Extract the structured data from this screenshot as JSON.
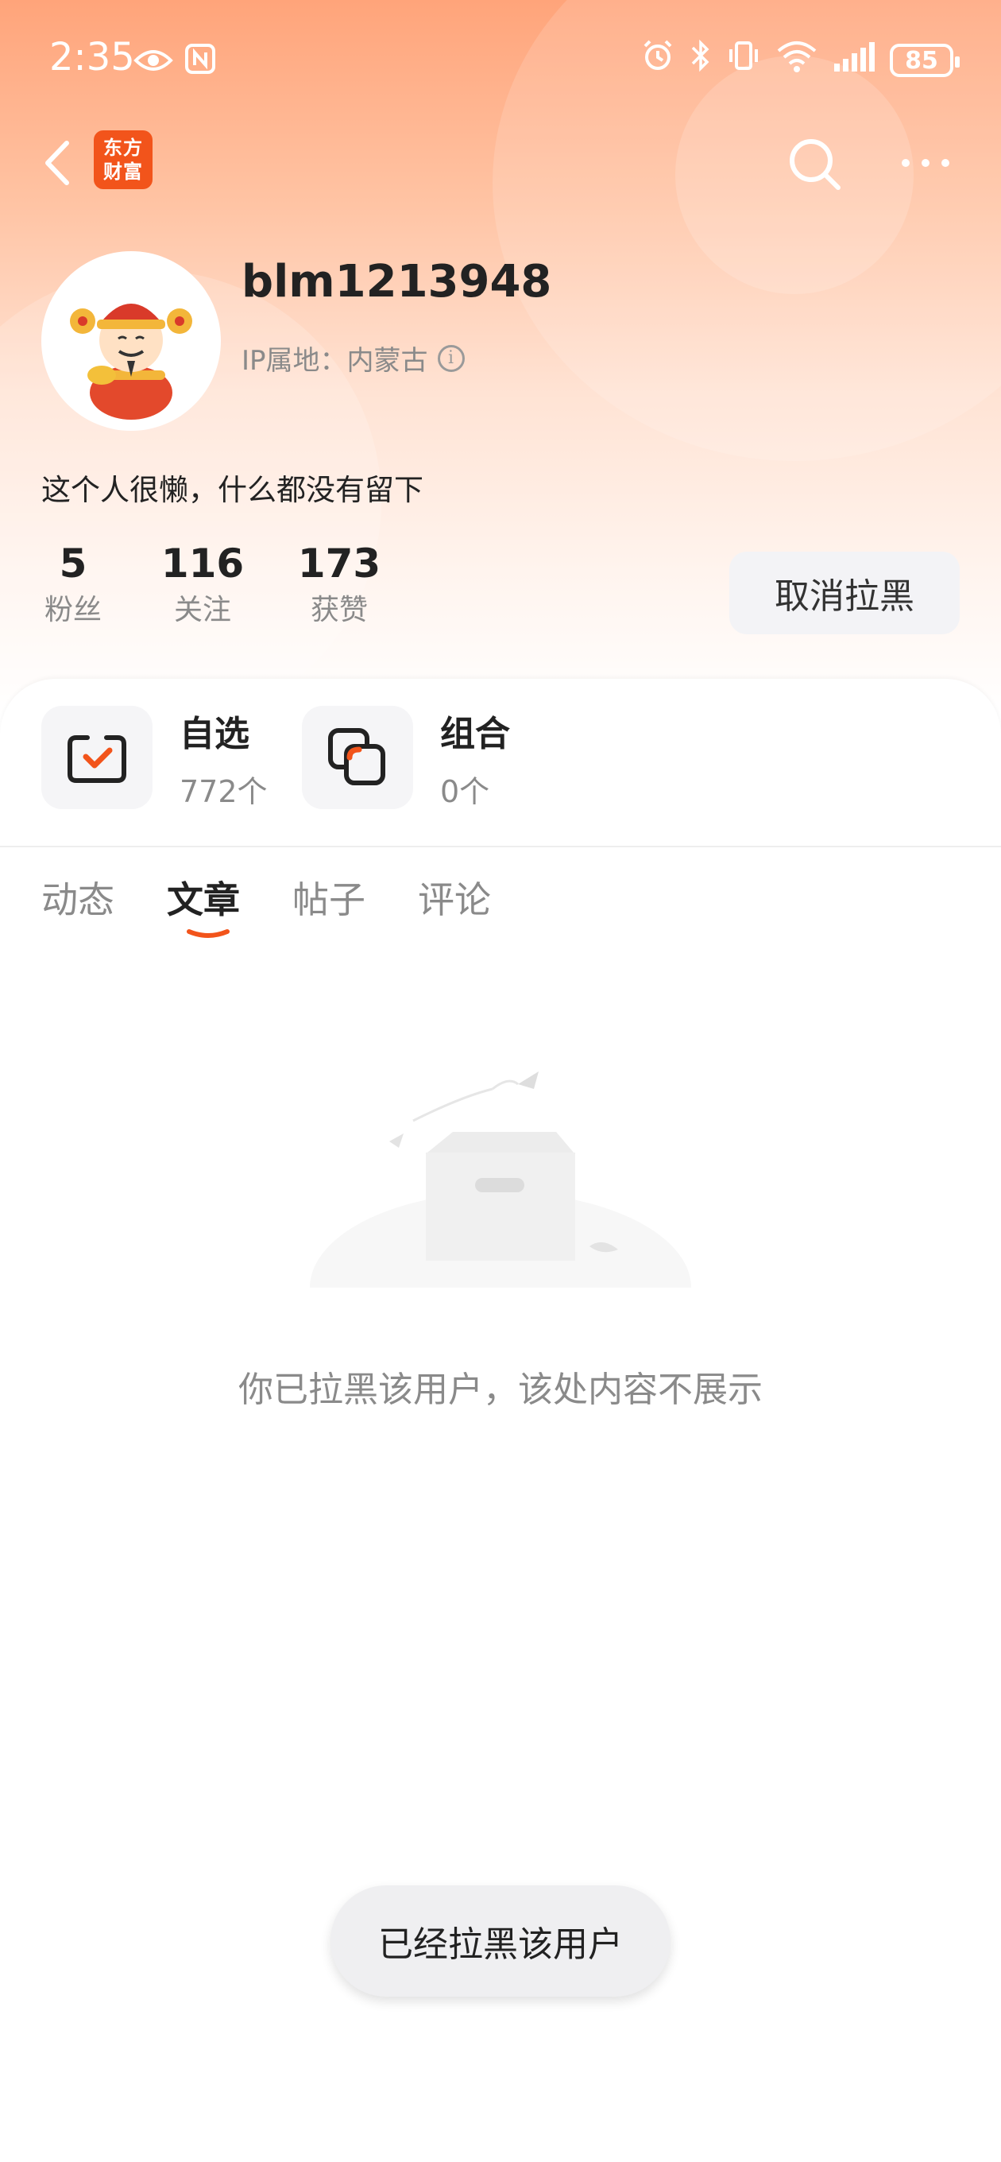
{
  "status_bar": {
    "time": "2:35",
    "battery": "85"
  },
  "app": {
    "logo_text_line1": "东方",
    "logo_text_line2": "财富"
  },
  "profile": {
    "username": "blm1213948",
    "ip_location": "IP属地：内蒙古",
    "bio": "这个人很懒，什么都没有留下",
    "stats": [
      {
        "value": "5",
        "label": "粉丝"
      },
      {
        "value": "116",
        "label": "关注"
      },
      {
        "value": "173",
        "label": "获赞"
      }
    ],
    "unblock_label": "取消拉黑"
  },
  "quick_entries": [
    {
      "title": "自选",
      "sub": "772个"
    },
    {
      "title": "组合",
      "sub": "0个"
    }
  ],
  "tabs": [
    {
      "label": "动态"
    },
    {
      "label": "文章"
    },
    {
      "label": "帖子"
    },
    {
      "label": "评论"
    }
  ],
  "active_tab": "文章",
  "empty_message": "你已拉黑该用户，该处内容不展示",
  "toast": "已经拉黑该用户",
  "colors": {
    "accent": "#f2541b",
    "header_top": "#ffa47a"
  }
}
